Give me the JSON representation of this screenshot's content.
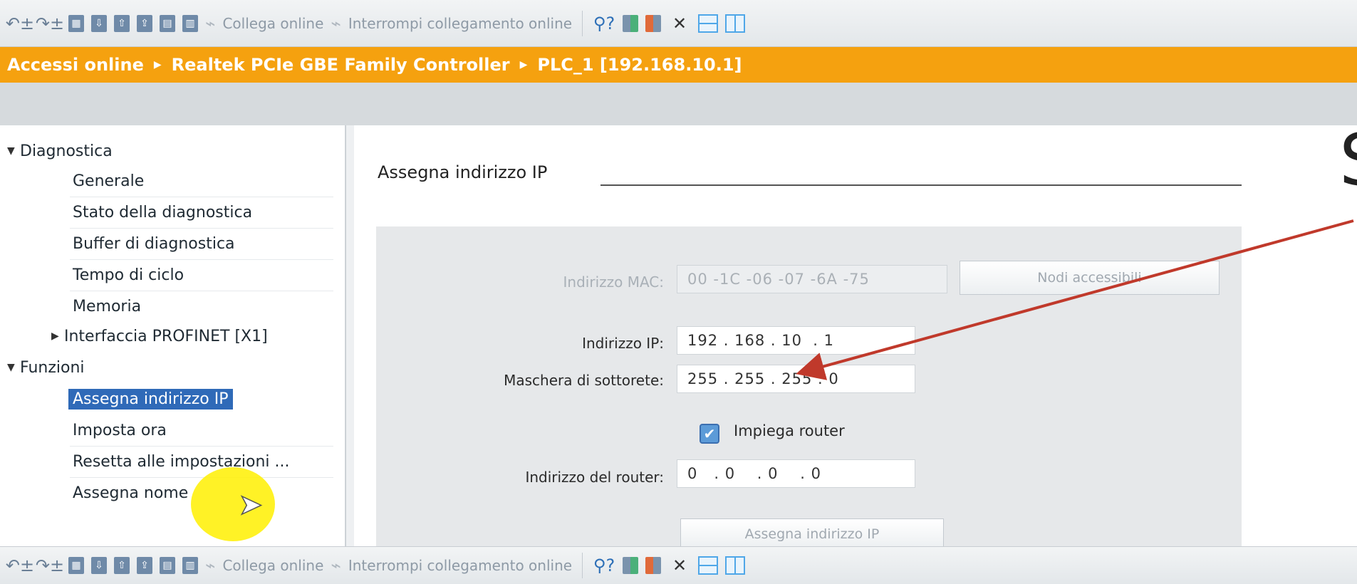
{
  "toolbar": {
    "go_online_label": "Collega online",
    "go_offline_label": "Interrompi collegamento online"
  },
  "breadcrumb": [
    "Accessi online",
    "Realtek PCIe GBE Family Controller",
    "PLC_1 [192.168.10.1]"
  ],
  "sidebar": {
    "diagnostica": "Diagnostica",
    "generale": "Generale",
    "stato": "Stato della diagnostica",
    "buffer": "Buffer di diagnostica",
    "tempo": "Tempo di ciclo",
    "memoria": "Memoria",
    "profinet": "Interfaccia PROFINET [X1]",
    "funzioni": "Funzioni",
    "assegna_ip": "Assegna indirizzo IP",
    "imposta_ora": "Imposta ora",
    "resetta": "Resetta alle impostazioni ...",
    "assegna_nome": "Assegna nome"
  },
  "main": {
    "section_title": "Assegna indirizzo IP",
    "mac_label": "Indirizzo MAC:",
    "mac_value": "00 -1C -06 -07 -6A -75",
    "accessible_nodes": "Nodi accessibili",
    "ip_label": "Indirizzo IP:",
    "ip_value": "192 . 168 . 10  . 1",
    "subnet_label": "Maschera di sottorete:",
    "subnet_value": "255 . 255 . 255 . 0",
    "router_checkbox": "Impiega router",
    "router_label": "Indirizzo del router:",
    "router_value": "0   . 0    . 0    . 0",
    "assign_button": "Assegna indirizzo IP"
  },
  "overlay": {
    "partial_letter": "S",
    "arrow_color": "#c0392b",
    "highlight_color": "#fff200"
  },
  "colors": {
    "breadcrumb_bg": "#f5a10f",
    "selected_bg": "#2f6ab8"
  }
}
